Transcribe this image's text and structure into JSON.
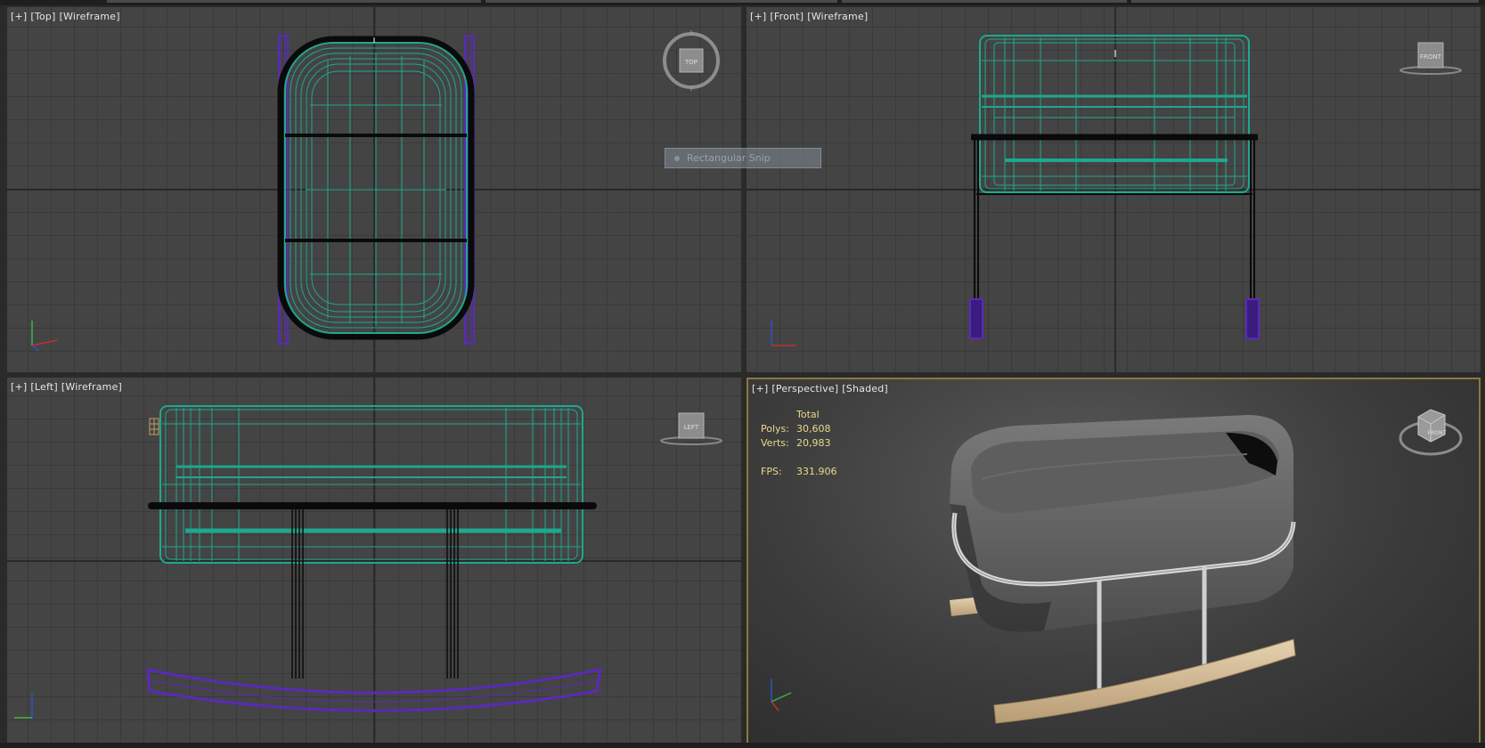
{
  "viewports": {
    "top": {
      "plus": "[+]",
      "view": "[Top]",
      "mode": "[Wireframe]",
      "cube_label": "TOP"
    },
    "front": {
      "plus": "[+]",
      "view": "[Front]",
      "mode": "[Wireframe]",
      "cube_label": "FRONT"
    },
    "left": {
      "plus": "[+]",
      "view": "[Left]",
      "mode": "[Wireframe]",
      "cube_label": "LEFT"
    },
    "persp": {
      "plus": "[+]",
      "view": "[Perspective]",
      "mode": "[Shaded]",
      "cube_label": "FRONT"
    }
  },
  "stats": {
    "header": "Total",
    "polys_label": "Polys:",
    "polys_value": "30,608",
    "verts_label": "Verts:",
    "verts_value": "20,983",
    "fps_label": "FPS:",
    "fps_value": "331.906"
  },
  "snip_tool": {
    "label": "Rectangular Snip"
  },
  "colors": {
    "wire_teal": "#1ea88e",
    "wire_purple": "#5a2ab8",
    "wire_black": "#0a0a0a",
    "viewport_bg": "#444444",
    "active_border": "#8a7a3c",
    "stats_text": "#e9d98a"
  },
  "icons": {
    "viewcube_top": "viewcube-icon",
    "axis_tripod": "axis-tripod-icon"
  }
}
